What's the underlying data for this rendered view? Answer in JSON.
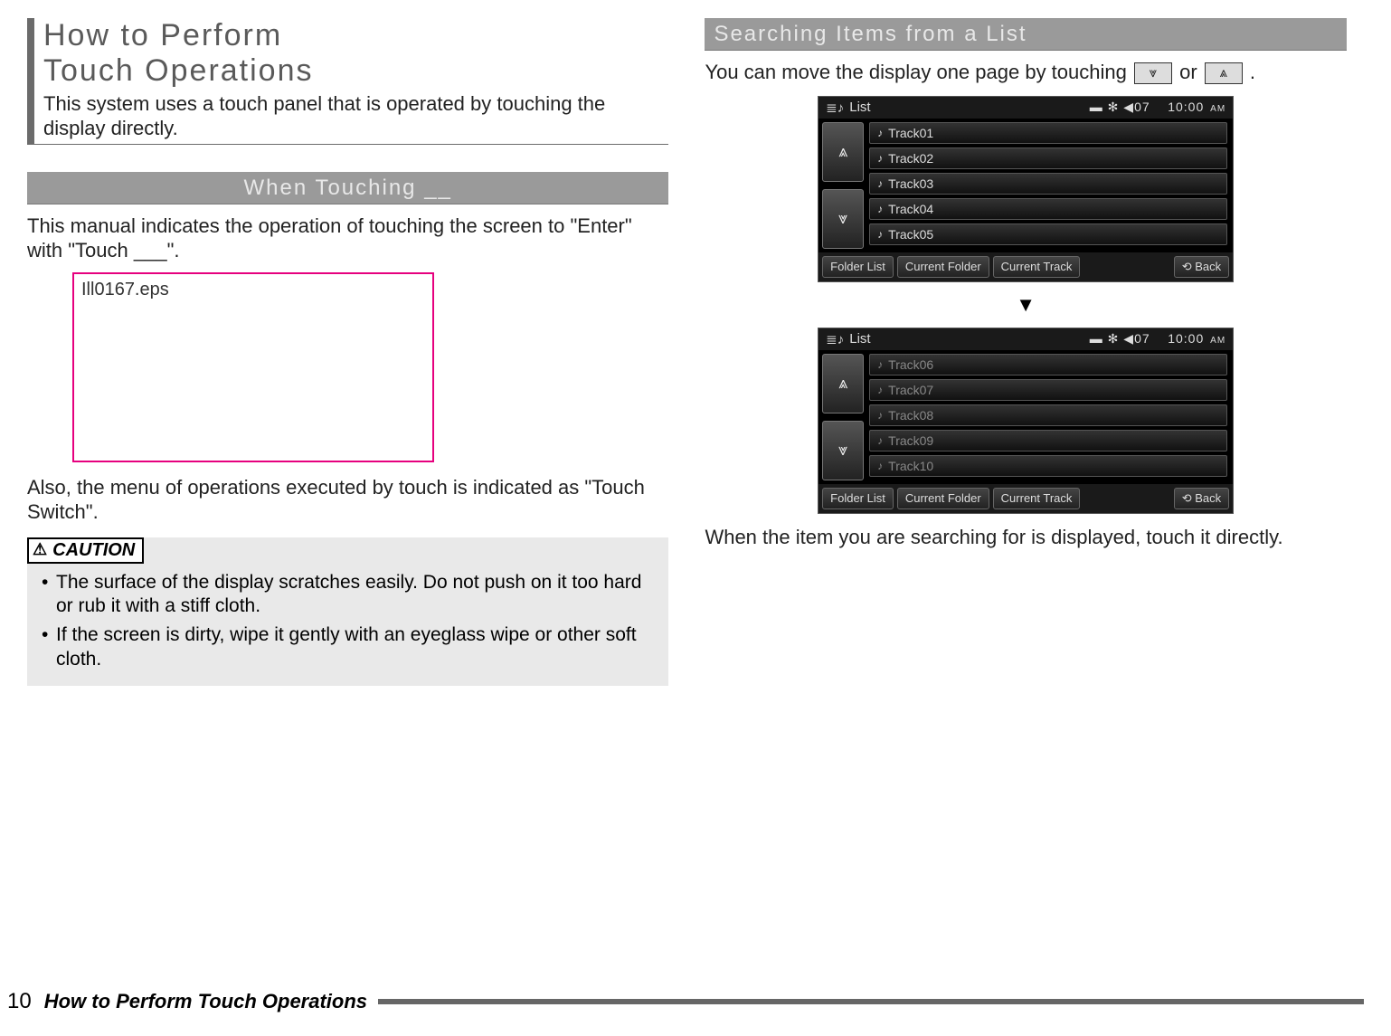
{
  "left": {
    "main_title_line1": "How to Perform",
    "main_title_line2": "Touch Operations",
    "main_subtitle": "This system uses a touch panel that is operated by touching the display directly.",
    "sub_heading": "When Touching __",
    "para1": "This manual indicates the operation of touching the screen to \"Enter\" with \"Touch ___\".",
    "placeholder_label": "Ill0167.eps",
    "para2": "Also, the menu of operations executed by touch is indicated as \"Touch Switch\".",
    "caution_label": "CAUTION",
    "caution_items": [
      "The surface of the display scratches easily. Do not push on it too hard or rub it with a stiff cloth.",
      "If the screen is dirty, wipe it gently with an eyeglass wipe or other soft cloth."
    ]
  },
  "right": {
    "sub_heading": "Searching Items from a List",
    "intro_pre": "You can move the display one page by touching ",
    "intro_mid": " or ",
    "intro_post": " .",
    "glyph_down": "⩔",
    "glyph_up": "⩓",
    "screenshot1": {
      "top_left_icon": "≣♪",
      "top_left_label": "List",
      "status_icons": "▬ ✻ ◀07",
      "time": "10:00",
      "ampm": "AM",
      "side_up": "⩓",
      "side_down": "⩔",
      "rows": [
        "Track01",
        "Track02",
        "Track03",
        "Track04",
        "Track05"
      ],
      "tabs": [
        "Folder List",
        "Current Folder",
        "Current Track"
      ],
      "back": "⟲ Back"
    },
    "arrow": "▼",
    "screenshot2": {
      "top_left_icon": "≣♪",
      "top_left_label": "List",
      "status_icons": "▬ ✻ ◀07",
      "time": "10:00",
      "ampm": "AM",
      "side_up": "⩓",
      "side_down": "⩔",
      "rows": [
        "Track06",
        "Track07",
        "Track08",
        "Track09",
        "Track10"
      ],
      "tabs": [
        "Folder List",
        "Current Folder",
        "Current Track"
      ],
      "back": "⟲ Back"
    },
    "outro": "When the item you are searching for is displayed, touch it directly."
  },
  "footer": {
    "page_number": "10",
    "title": "How to Perform Touch Operations"
  }
}
